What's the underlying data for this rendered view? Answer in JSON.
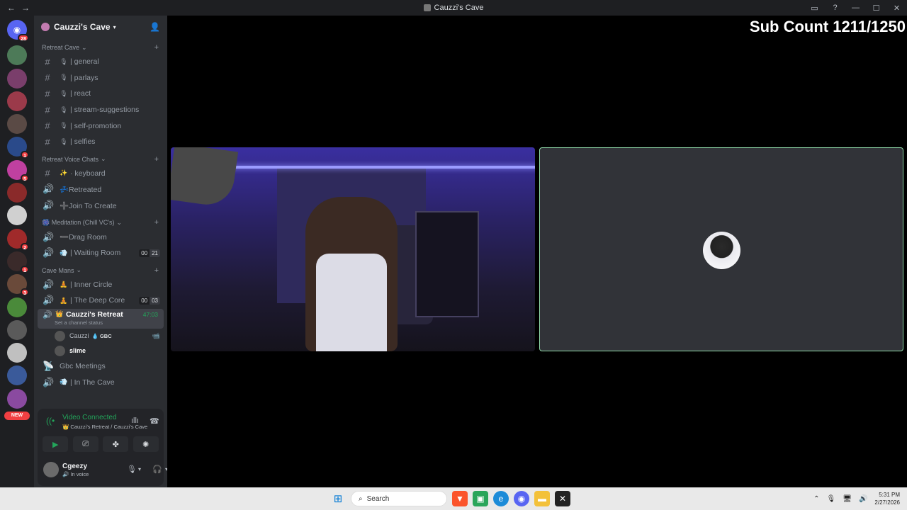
{
  "window": {
    "title": "Cauzzi's Cave",
    "back_glyph": "←",
    "forward_glyph": "→",
    "inbox_icon": "inbox-icon",
    "help_icon": "help-icon",
    "min_glyph": "—",
    "max_glyph": "☐",
    "close_glyph": "✕"
  },
  "guilds": {
    "home_badge": "28",
    "items": [
      {
        "color": "#4d7a58",
        "badge": ""
      },
      {
        "color": "#7a3e6b",
        "badge": ""
      },
      {
        "color": "#9b3a4a",
        "badge": ""
      },
      {
        "color": "#5a4a45",
        "badge": ""
      },
      {
        "color": "#2a4a8a",
        "badge": "1"
      },
      {
        "color": "#c040a0",
        "badge": "5"
      },
      {
        "color": "#8a2a2a",
        "badge": ""
      },
      {
        "color": "#d0d0d0",
        "badge": ""
      },
      {
        "color": "#a02a2a",
        "badge": "2"
      },
      {
        "color": "#3a2a2a",
        "badge": "1"
      },
      {
        "color": "#6a4a3a",
        "badge": "3"
      },
      {
        "color": "#4a8a3a",
        "badge": ""
      },
      {
        "color": "#5a5a5a",
        "badge": ""
      },
      {
        "color": "#c0c0c0",
        "badge": ""
      },
      {
        "color": "#3a5a9a",
        "badge": ""
      },
      {
        "color": "#8a4aa0",
        "badge": ""
      }
    ],
    "new_label": "NEW"
  },
  "server": {
    "name": "Cauzzi's Cave",
    "add_icon": "add-friend-icon"
  },
  "categories": [
    {
      "name": "Retreat Cave",
      "channels": [
        {
          "icon": "#",
          "emoji": "🎙",
          "name": "| general"
        },
        {
          "icon": "#",
          "emoji": "🎙",
          "name": "| parlays"
        },
        {
          "icon": "#",
          "emoji": "🎙",
          "name": "| react"
        },
        {
          "icon": "#",
          "emoji": "🎙",
          "name": "| stream-suggestions"
        },
        {
          "icon": "#",
          "emoji": "🎙",
          "name": "| self-promotion"
        },
        {
          "icon": "#",
          "emoji": "🎙",
          "name": "| selfies"
        }
      ]
    },
    {
      "name": "Retreat Voice Chats",
      "channels": [
        {
          "icon": "#",
          "emoji": "✨",
          "name": "· keyboard"
        },
        {
          "icon": "🔊",
          "emoji": "",
          "name": "💤Retreated"
        },
        {
          "icon": "🔊",
          "emoji": "",
          "name": "➕Join To Create"
        }
      ]
    },
    {
      "name": "🎆 Meditation (Chill VC's)",
      "channels": [
        {
          "icon": "🔊",
          "emoji": "",
          "name": "➖Drag Room"
        },
        {
          "icon": "🔊",
          "emoji": "💨",
          "name": "| Waiting Room",
          "cnt_a": "00",
          "cnt_b": "21"
        }
      ]
    },
    {
      "name": "Cave Mans",
      "channels": [
        {
          "icon": "🔊",
          "emoji": "🧘",
          "name": "| Inner Circle"
        },
        {
          "icon": "🔊",
          "emoji": "🧘",
          "name": "| The Deep Core",
          "cnt_a": "00",
          "cnt_b": "03"
        }
      ]
    }
  ],
  "active_channel": {
    "icon": "🔊",
    "emoji": "👑",
    "name": "Cauzzi's Retreat",
    "timer": "47:03",
    "status_hint": "Set a channel status"
  },
  "voice_users": [
    {
      "name": "Cauzzi",
      "tag": "💧 GBC",
      "camera": "📹"
    },
    {
      "name": "slime",
      "tag": "",
      "camera": ""
    }
  ],
  "after_channels": [
    {
      "icon": "📡",
      "emoji": "",
      "name": "Gbc Meetings"
    },
    {
      "icon": "🔊",
      "emoji": "💨",
      "name": "| In The Cave"
    }
  ],
  "voice_panel": {
    "status": "Video Connected",
    "location": "👑 Cauzzi's Retreat / Cauzzi's Cave"
  },
  "user": {
    "name": "Cgeezy",
    "status": "🔊 In voice"
  },
  "stage": {
    "overlay_text": "Sub Count 1211/1250"
  },
  "taskbar": {
    "search_placeholder": "Search",
    "clock_time": "5:31 PM",
    "clock_date": "2/27/2026"
  }
}
